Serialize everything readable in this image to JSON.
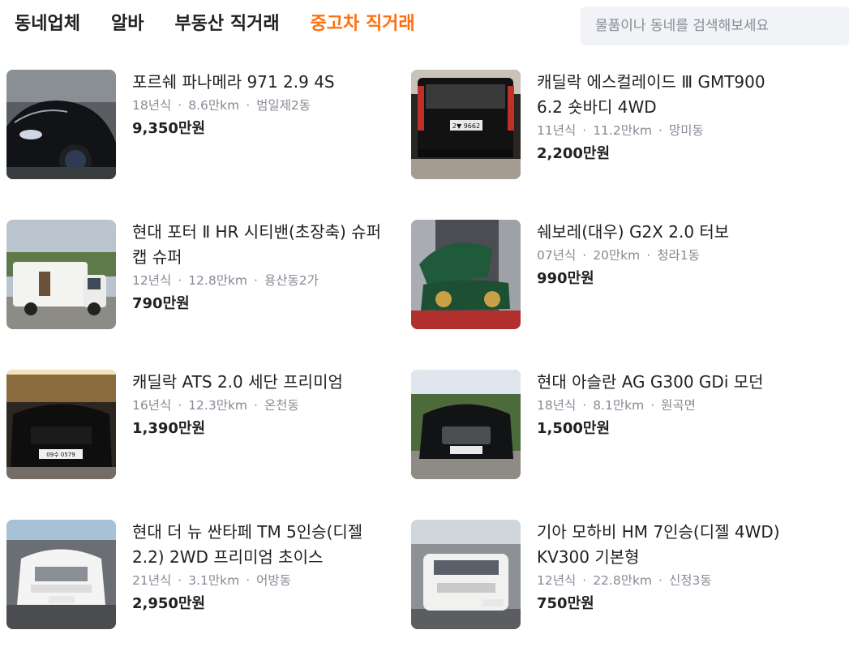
{
  "nav": {
    "items": [
      "동네업체",
      "알바",
      "부동산 직거래",
      "중고차 직거래"
    ],
    "active_index": 3,
    "active_color": "#ff6f0f"
  },
  "search": {
    "placeholder": "물품이나 동네를 검색해보세요"
  },
  "listings": [
    {
      "title": "포르쉐 파나메라 971 2.9 4S",
      "year": "18년식",
      "mileage": "8.6만km",
      "location": "범일제2동",
      "price": "9,350만원",
      "image": "black-porsche-panamera"
    },
    {
      "title": "캐딜락 에스컬레이드 Ⅲ GMT900 6.2 숏바디 4WD",
      "year": "11년식",
      "mileage": "11.2만km",
      "location": "망미동",
      "price": "2,200만원",
      "image": "black-cadillac-escalade-rear",
      "plate": "2▼ 9662"
    },
    {
      "title": "현대 포터 Ⅱ HR 시티밴(초장축) 슈퍼캡 슈퍼",
      "year": "12년식",
      "mileage": "12.8만km",
      "location": "용산동2가",
      "price": "790만원",
      "image": "white-camper-truck"
    },
    {
      "title": "쉐보레(대우) G2X 2.0 터보",
      "year": "07년식",
      "mileage": "20만km",
      "location": "청라1동",
      "price": "990만원",
      "image": "green-convertible-hood-open"
    },
    {
      "title": "캐딜락 ATS 2.0 세단 프리미엄",
      "year": "16년식",
      "mileage": "12.3만km",
      "location": "온천동",
      "price": "1,390만원",
      "image": "black-cadillac-ats-front",
      "plate": "09수 0579"
    },
    {
      "title": "현대 아슬란 AG G300 GDi 모던",
      "year": "18년식",
      "mileage": "8.1만km",
      "location": "원곡면",
      "price": "1,500만원",
      "image": "black-hyundai-aslan-front"
    },
    {
      "title": "현대 더 뉴 싼타페 TM 5인승(디젤 2.2) 2WD 프리미엄 초이스",
      "year": "21년식",
      "mileage": "3.1만km",
      "location": "어방동",
      "price": "2,950만원",
      "image": "white-santafe-front"
    },
    {
      "title": "기아 모하비 HM 7인승(디젤 4WD) KV300 기본형",
      "year": "12년식",
      "mileage": "22.8만km",
      "location": "신정3동",
      "price": "750만원",
      "image": "white-mohave-front"
    }
  ]
}
